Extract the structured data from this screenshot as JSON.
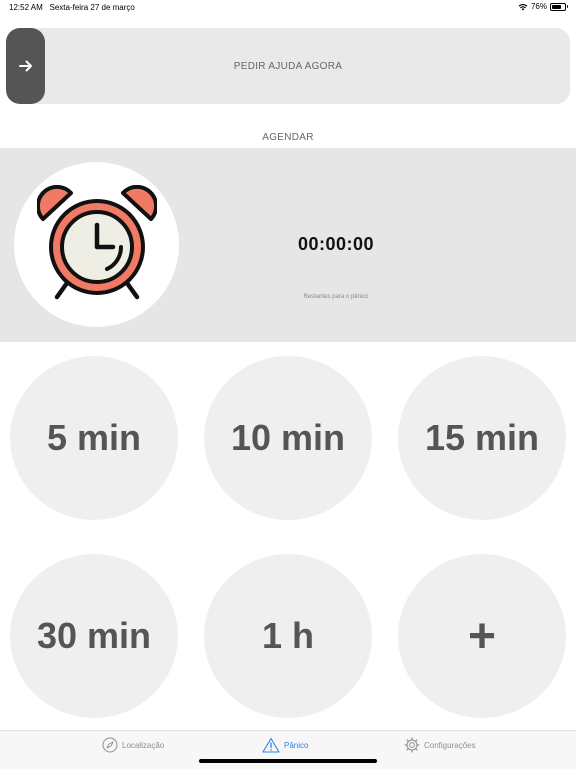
{
  "status_bar": {
    "time": "12:52 AM",
    "date": "Sexta-feira 27 de março",
    "battery": "76%",
    "battery_level": 0.76
  },
  "panic_slider": {
    "label": "PEDIR AJUDA AGORA",
    "knob_icon": "arrow-right-icon"
  },
  "schedule": {
    "title": "AGENDAR",
    "countdown": "00:00:00",
    "caption": "Restantes para o pânico",
    "clock_icon": "alarm-clock-icon"
  },
  "presets": [
    {
      "label": "5 min"
    },
    {
      "label": "10 min"
    },
    {
      "label": "15 min"
    },
    {
      "label": "30 min"
    },
    {
      "label": "1 h"
    },
    {
      "label": "+"
    }
  ],
  "tab_bar": {
    "tabs": [
      {
        "label": "Localização",
        "icon": "compass-icon",
        "active": false
      },
      {
        "label": "Pânico",
        "icon": "warning-icon",
        "active": true
      },
      {
        "label": "Configurações",
        "icon": "gear-icon",
        "active": false
      }
    ],
    "active_color": "#2f80ed",
    "inactive_color": "#8e8e93"
  },
  "colors": {
    "clock_red": "#f07a63",
    "clock_face": "#eeeee5",
    "knob": "#555555",
    "panel": "#e6e6e6"
  }
}
